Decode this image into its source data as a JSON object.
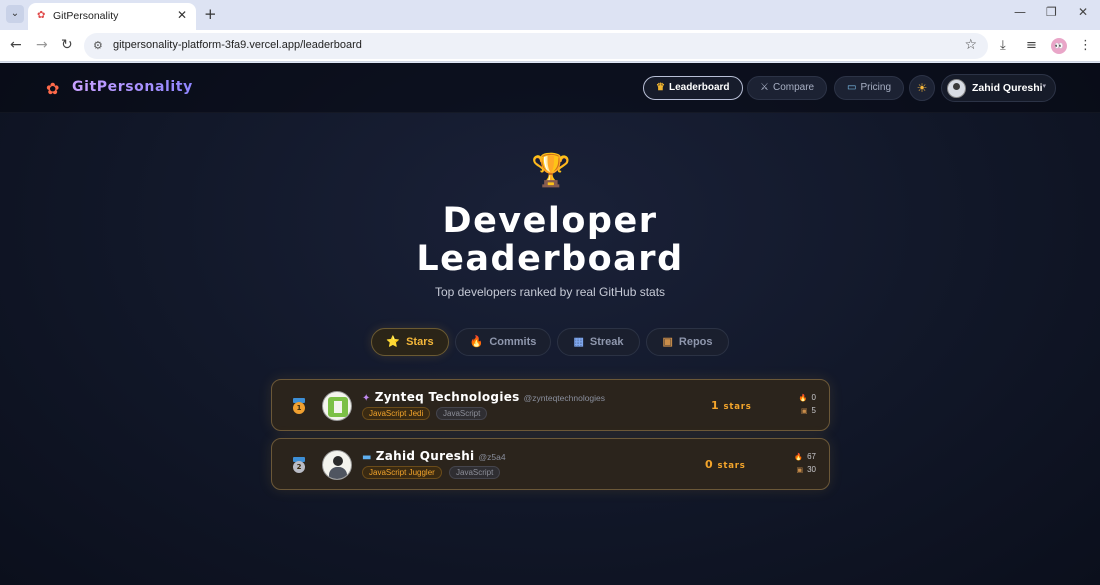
{
  "browser": {
    "tab_title": "GitPersonality",
    "url": "gitpersonality-platform-3fa9.vercel.app/leaderboard"
  },
  "site": {
    "logo_text": "GitPersonality",
    "nav": [
      {
        "label": "Leaderboard",
        "icon": "trophy-icon",
        "active": true
      },
      {
        "label": "Compare",
        "icon": "crossed-swords-icon",
        "active": false
      },
      {
        "label": "Pricing",
        "icon": "credit-card-icon",
        "active": false
      }
    ],
    "user_name": "Zahid Qureshi"
  },
  "hero": {
    "title_line1": "Developer",
    "title_line2": "Leaderboard",
    "subtitle": "Top developers ranked by real GitHub stats"
  },
  "filters": [
    {
      "label": "Stars",
      "icon": "star-icon",
      "active": true
    },
    {
      "label": "Commits",
      "icon": "fire-icon",
      "active": false
    },
    {
      "label": "Streak",
      "icon": "calendar-icon",
      "active": false
    },
    {
      "label": "Repos",
      "icon": "package-icon",
      "active": false
    }
  ],
  "leaderboard": [
    {
      "rank": "1",
      "name": "Zynteq Technologies",
      "handle": "@zynteqtechnologies",
      "personality": "JavaScript Jedi",
      "language": "JavaScript",
      "stars_value": "1",
      "stars_label": "stars",
      "streak": "0",
      "repos": "5",
      "colors": {
        "medal": "#f0a030"
      }
    },
    {
      "rank": "2",
      "name": "Zahid Qureshi",
      "handle": "@z5a4",
      "personality": "JavaScript Juggler",
      "language": "JavaScript",
      "stars_value": "0",
      "stars_label": "stars",
      "streak": "67",
      "repos": "30",
      "colors": {
        "medal": "#b9bcc6"
      }
    }
  ],
  "colors": {
    "accent": "#f4b73a",
    "page_bg": "#111728",
    "logo_gradient_start": "#c9a0ff",
    "logo_gradient_end": "#8f86ff"
  }
}
